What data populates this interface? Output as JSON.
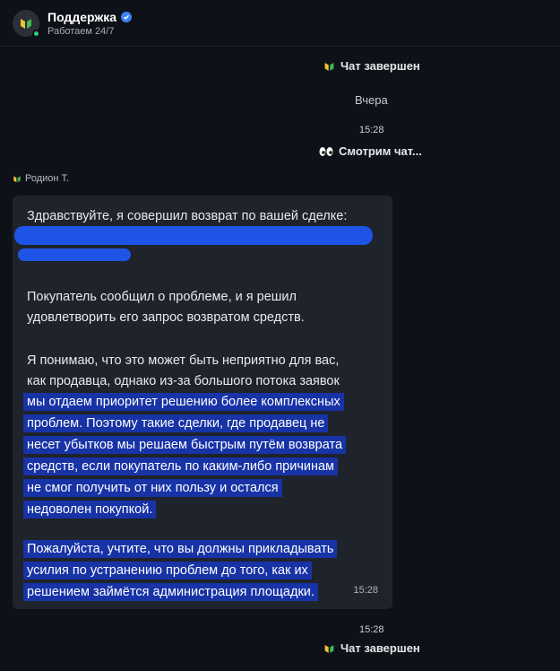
{
  "header": {
    "title": "Поддержка",
    "subtitle": "Работаем 24/7",
    "avatar_icon": "leaf-badge-icon",
    "verified_icon": "verified-check-icon",
    "online_color": "#2ecc71"
  },
  "chat": {
    "status_closed_1": "Чат завершен",
    "day_label": "Вчера",
    "time_1": "15:28",
    "status_watching": "Смотрим чат...",
    "sender_name": "Родион Т.",
    "message": {
      "line_1": "Здравствуйте, я совершил возврат по вашей сделке:",
      "line_2": "Покупатель сообщил о проблеме, и я решил",
      "line_3": "удовлетворить его запрос возвратом средств.",
      "line_4": "Я понимаю, что это может быть неприятно для вас,",
      "line_5": "как продавца, однако из-за большого потока заявок",
      "line_6": "мы отдаем приоритет решению более комплексных",
      "line_7": "проблем. Поэтому такие сделки, где продавец не",
      "line_8": "несет убытков мы решаем быстрым путём возврата",
      "line_9": "средств, если покупатель по каким-либо причинам",
      "line_10": "не смог получить от них пользу и остался",
      "line_11": "недоволен покупкой.",
      "line_12": "Пожалуйста, учтите, что вы должны прикладывать",
      "line_13": "усилия по устранению проблем до того, как их",
      "line_14": "решением займётся администрация площадки.",
      "time": "15:28"
    },
    "time_2": "15:28",
    "status_closed_2": "Чат завершен"
  },
  "colors": {
    "background": "#0e1117",
    "bubble": "#1f232b",
    "selection": "#1733a6",
    "redaction": "#1e54e6"
  }
}
